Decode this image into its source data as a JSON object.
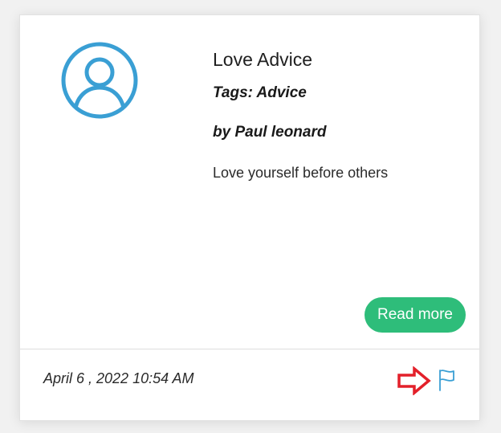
{
  "post": {
    "title": "Love Advice",
    "tags": "Tags: Advice",
    "author": "by Paul leonard",
    "excerpt": "Love yourself before others",
    "read_more_label": "Read more",
    "date": "April 6 , 2022 10:54 AM"
  },
  "icons": {
    "avatar": "user-circle-icon",
    "annotation": "red-arrow-right-icon",
    "flag": "flag-icon"
  },
  "colors": {
    "accent": "#3a9fd4",
    "button": "#2ebd7a",
    "annotation": "#e3202a"
  }
}
